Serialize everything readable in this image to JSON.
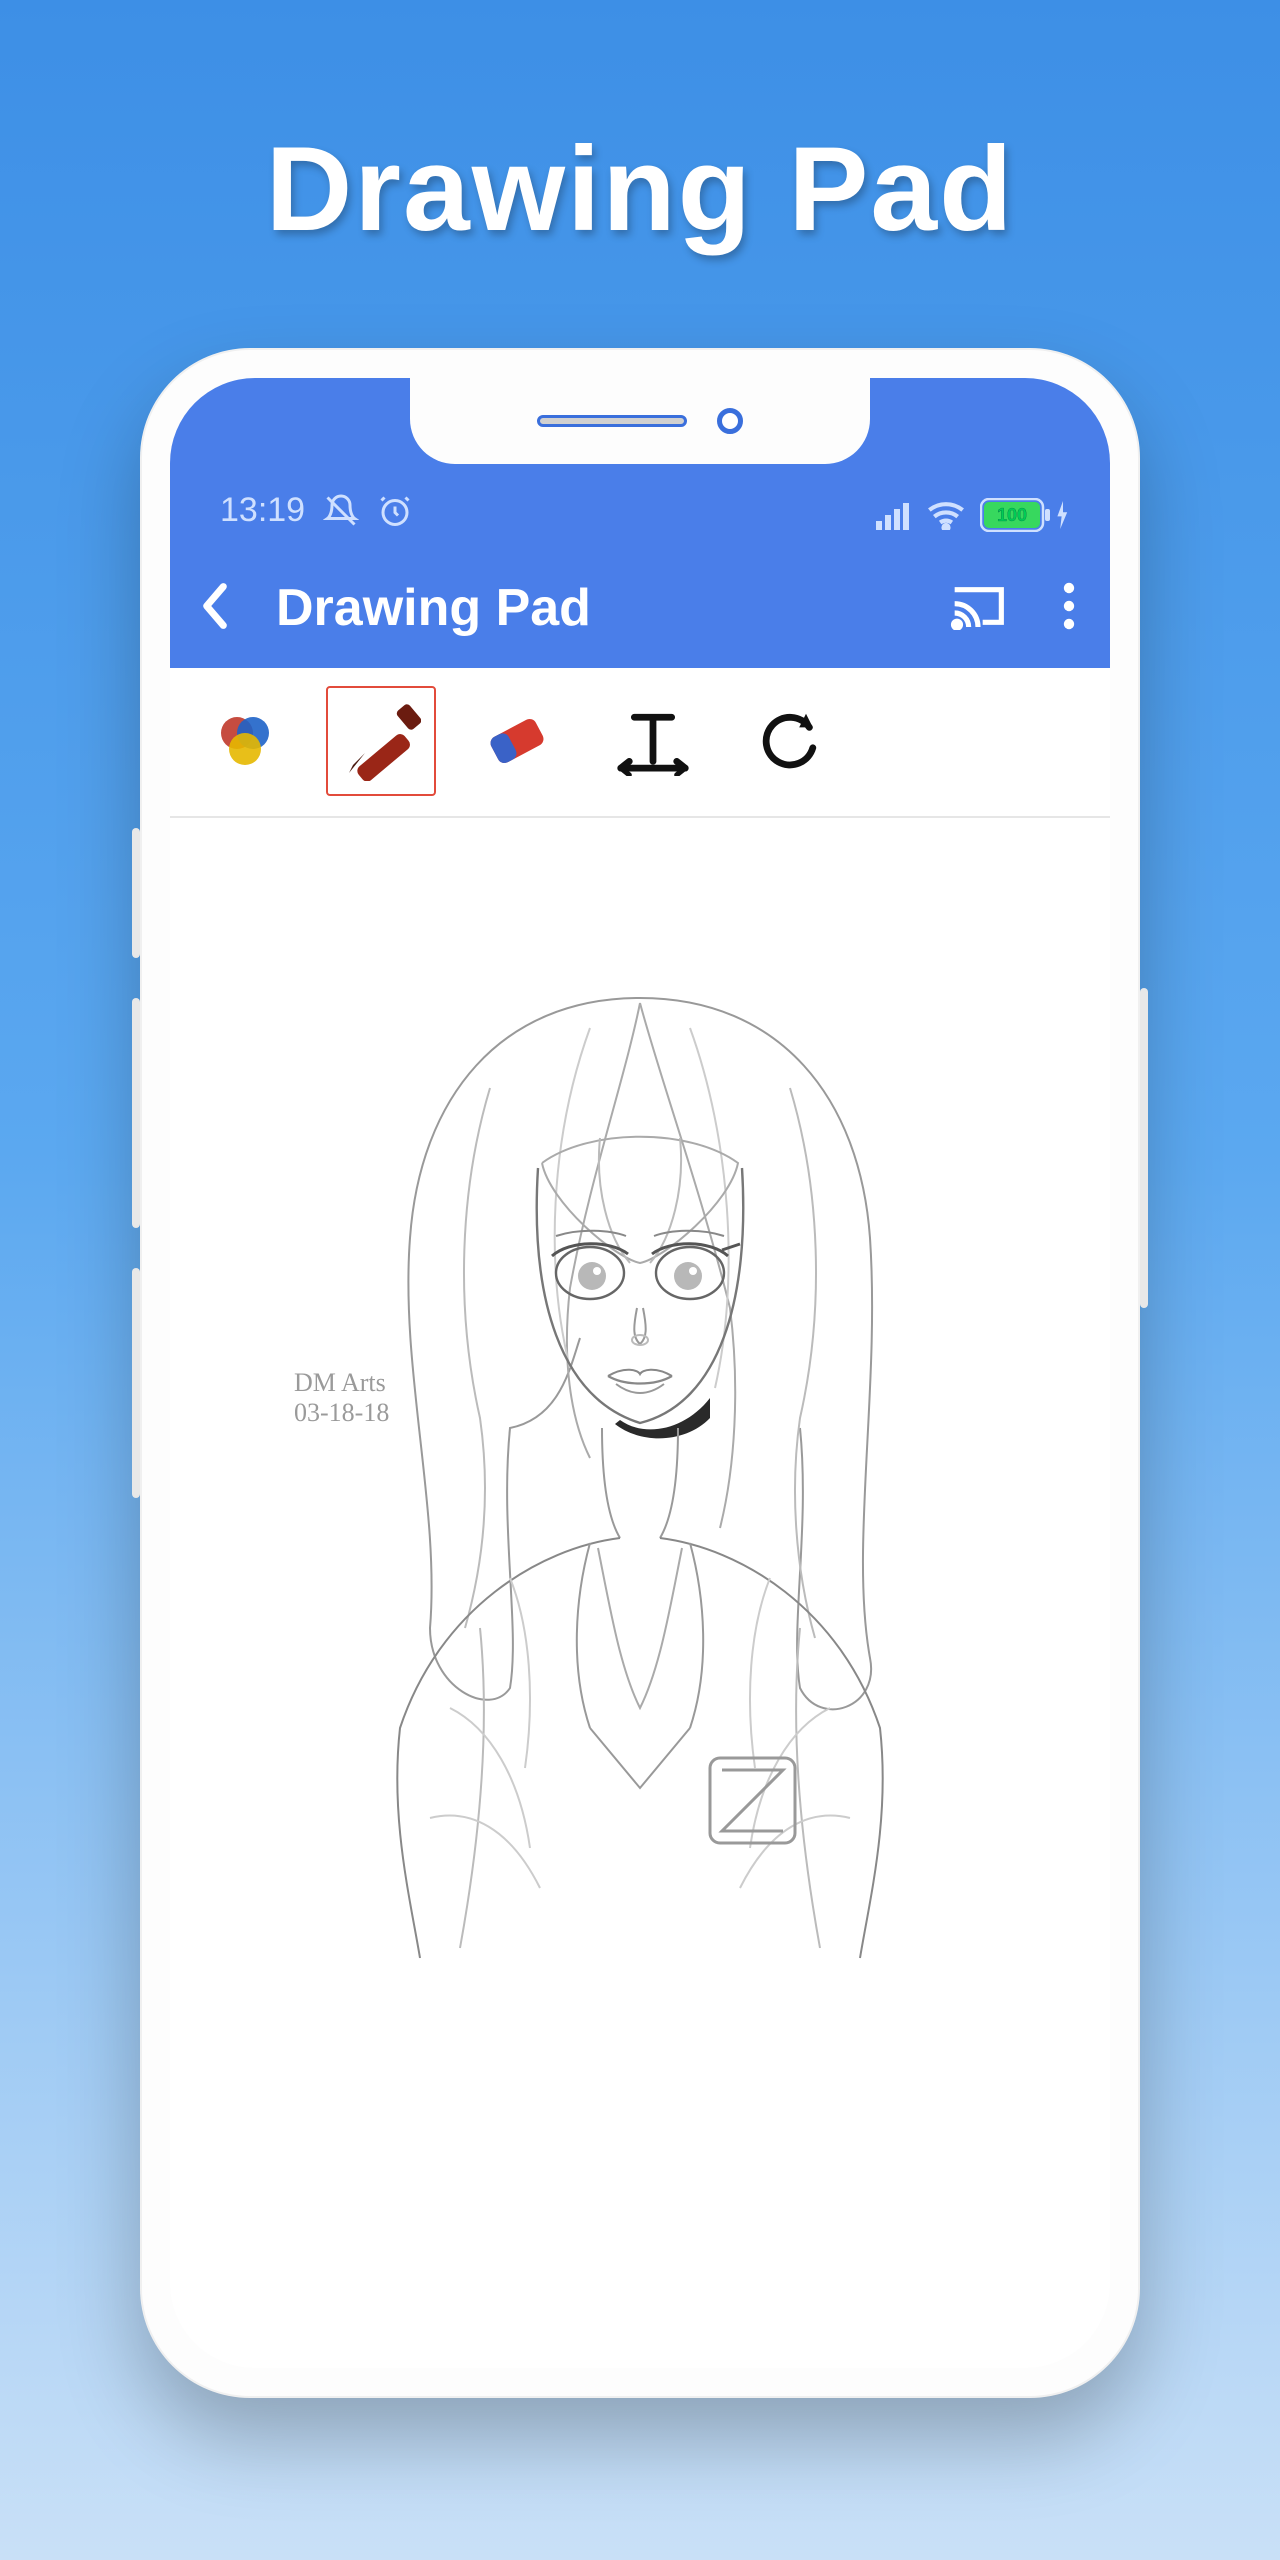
{
  "headline": "Drawing Pad",
  "status": {
    "time": "13:19",
    "battery_pct": "100",
    "icons": [
      "mute-icon",
      "alarm-icon",
      "signal-icon",
      "wifi-icon",
      "battery-icon"
    ]
  },
  "appbar": {
    "title": "Drawing Pad",
    "actions": [
      "cast-icon",
      "more-icon"
    ]
  },
  "tools": {
    "items": [
      {
        "name": "color-picker",
        "selected": false
      },
      {
        "name": "pen",
        "selected": true
      },
      {
        "name": "eraser",
        "selected": false
      },
      {
        "name": "text",
        "selected": false
      },
      {
        "name": "rotate",
        "selected": false
      }
    ]
  },
  "canvas": {
    "signature_name": "DM Arts",
    "signature_date": "03-18-18"
  }
}
